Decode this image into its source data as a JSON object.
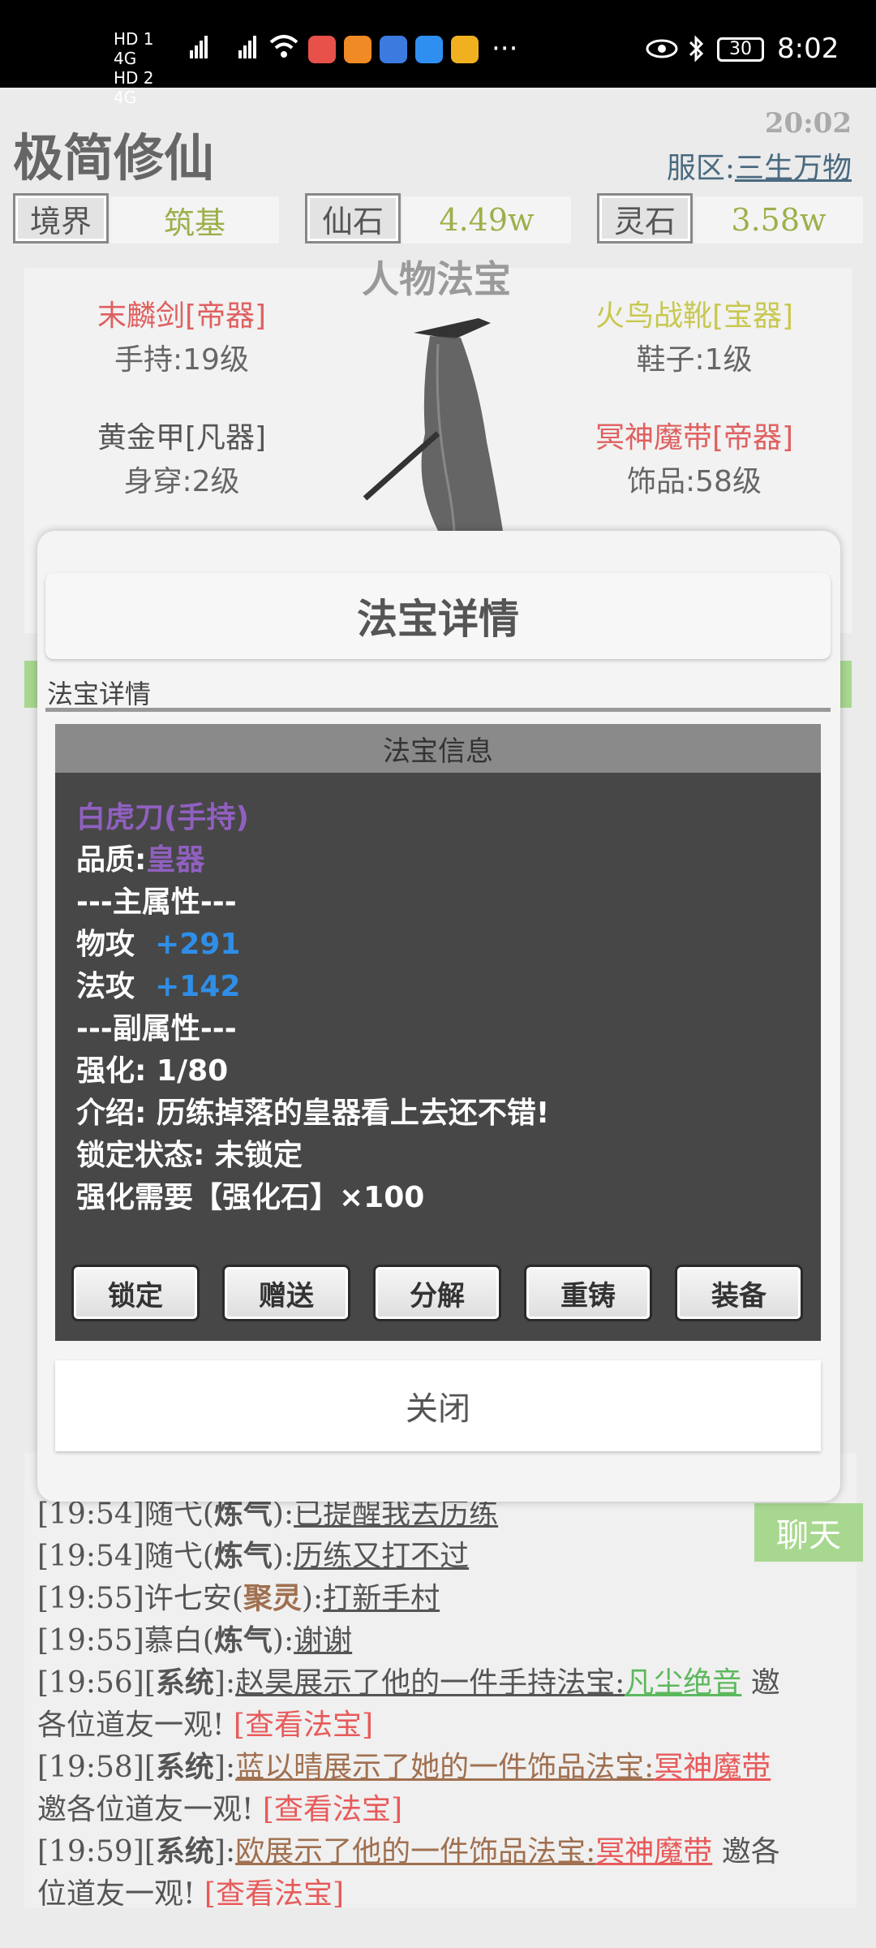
{
  "status_bar": {
    "net": "HD 1 4G HD 2 4G",
    "more": "···",
    "battery": "30",
    "clock": "8:02"
  },
  "header": {
    "title": "极简修仙",
    "time": "20:02",
    "server_label": "服区:",
    "server_name": "三生万物"
  },
  "stats": [
    {
      "label": "境界",
      "value": "筑基"
    },
    {
      "label": "仙石",
      "value": "4.49w"
    },
    {
      "label": "灵石",
      "value": "3.58w"
    }
  ],
  "equipment": {
    "title": "人物法宝",
    "items": [
      {
        "name": "末麟剑[帝器]",
        "slot": "手持:19级"
      },
      {
        "name": "火鸟战靴[宝器]",
        "slot": "鞋子:1级"
      },
      {
        "name": "黄金甲[凡器]",
        "slot": "身穿:2级"
      },
      {
        "name": "冥神魔带[帝器]",
        "slot": "饰品:58级"
      }
    ]
  },
  "modal": {
    "title": "法宝详情",
    "subtitle": "法宝详情",
    "info_header": "法宝信息",
    "item_name": "白虎刀(手持)",
    "quality_label": "品质:",
    "quality_value": "皇器",
    "main_attr_header": "---主属性---",
    "phys_label": "物攻",
    "phys_value": "+291",
    "magic_label": "法攻",
    "magic_value": "+142",
    "sub_attr_header": "---副属性---",
    "enhance": "强化: 1/80",
    "intro": "介绍: 历练掉落的皇器看上去还不错!",
    "lock_state": "锁定状态: 未锁定",
    "enhance_need": "强化需要【强化石】×100",
    "buttons": [
      "锁定",
      "赠送",
      "分解",
      "重铸",
      "装备"
    ],
    "close": "关闭"
  },
  "chat": {
    "button": "聊天",
    "lines": [
      {
        "time": "[19:54]",
        "name": "随弋",
        "rank": "炼气",
        "text": "已提醒我去历练"
      },
      {
        "time": "[19:54]",
        "name": "随弋",
        "rank": "炼气",
        "text": "历练又打不过"
      },
      {
        "time": "[19:55]",
        "name": "许七安",
        "rank": "聚灵",
        "text": "打新手村"
      },
      {
        "time": "[19:55]",
        "name": "慕白",
        "rank": "炼气",
        "text": "谢谢"
      }
    ],
    "system": [
      {
        "time": "[19:56]",
        "tag": "系统",
        "pre": "赵昊展示了他的一件手持法宝:",
        "item": "凡尘绝音",
        "post": " 邀",
        "cont": "各位道友一观!",
        "link": "[查看法宝]"
      },
      {
        "time": "[19:58]",
        "tag": "系统",
        "pre": "蓝以晴展示了她的一件饰品法宝:",
        "item": "冥神魔带",
        "post": "",
        "cont": "邀各位道友一观!",
        "link": "[查看法宝]"
      },
      {
        "time": "[19:59]",
        "tag": "系统",
        "pre": "欧展示了他的一件饰品法宝:",
        "item": "冥神魔带",
        "post": " 邀各",
        "cont": "位道友一观!",
        "link": "[查看法宝]"
      }
    ]
  }
}
